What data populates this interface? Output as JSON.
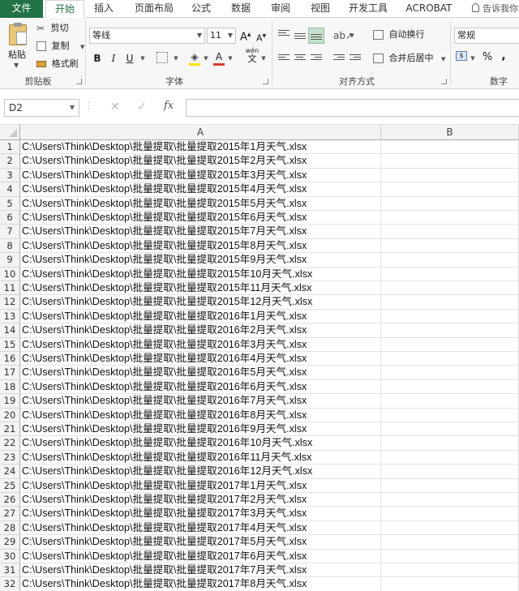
{
  "tabs": {
    "file": "文件",
    "home": "开始",
    "insert": "插入",
    "page_layout": "页面布局",
    "formulas": "公式",
    "data": "数据",
    "review": "审阅",
    "view": "视图",
    "developer": "开发工具",
    "acrobat": "ACROBAT",
    "tell_me": "告诉我你"
  },
  "ribbon": {
    "clipboard": {
      "paste": "粘贴",
      "cut": "剪切",
      "copy": "复制",
      "format_painter": "格式刷",
      "group_label": "剪贴板"
    },
    "font": {
      "font_name": "等线",
      "font_size": "11",
      "bold": "B",
      "italic": "I",
      "underline": "U",
      "phonetic": "wén",
      "phonetic_char": "文",
      "group_label": "字体"
    },
    "alignment": {
      "wrap_text": "自动换行",
      "merge_center": "合并后居中",
      "group_label": "对齐方式"
    },
    "number": {
      "format": "常规",
      "percent": "%",
      "comma": ",",
      "group_label": "数字"
    }
  },
  "formula_bar": {
    "name_box": "D2",
    "fx": "fx",
    "formula": ""
  },
  "columns": [
    "A",
    "B"
  ],
  "rows": [
    {
      "num": "1",
      "a": "C:\\Users\\Think\\Desktop\\批量提取\\批量提取2015年1月天气.xlsx"
    },
    {
      "num": "2",
      "a": "C:\\Users\\Think\\Desktop\\批量提取\\批量提取2015年2月天气.xlsx"
    },
    {
      "num": "3",
      "a": "C:\\Users\\Think\\Desktop\\批量提取\\批量提取2015年3月天气.xlsx"
    },
    {
      "num": "4",
      "a": "C:\\Users\\Think\\Desktop\\批量提取\\批量提取2015年4月天气.xlsx"
    },
    {
      "num": "5",
      "a": "C:\\Users\\Think\\Desktop\\批量提取\\批量提取2015年5月天气.xlsx"
    },
    {
      "num": "6",
      "a": "C:\\Users\\Think\\Desktop\\批量提取\\批量提取2015年6月天气.xlsx"
    },
    {
      "num": "7",
      "a": "C:\\Users\\Think\\Desktop\\批量提取\\批量提取2015年7月天气.xlsx"
    },
    {
      "num": "8",
      "a": "C:\\Users\\Think\\Desktop\\批量提取\\批量提取2015年8月天气.xlsx"
    },
    {
      "num": "9",
      "a": "C:\\Users\\Think\\Desktop\\批量提取\\批量提取2015年9月天气.xlsx"
    },
    {
      "num": "10",
      "a": "C:\\Users\\Think\\Desktop\\批量提取\\批量提取2015年10月天气.xlsx"
    },
    {
      "num": "11",
      "a": "C:\\Users\\Think\\Desktop\\批量提取\\批量提取2015年11月天气.xlsx"
    },
    {
      "num": "12",
      "a": "C:\\Users\\Think\\Desktop\\批量提取\\批量提取2015年12月天气.xlsx"
    },
    {
      "num": "13",
      "a": "C:\\Users\\Think\\Desktop\\批量提取\\批量提取2016年1月天气.xlsx"
    },
    {
      "num": "14",
      "a": "C:\\Users\\Think\\Desktop\\批量提取\\批量提取2016年2月天气.xlsx"
    },
    {
      "num": "15",
      "a": "C:\\Users\\Think\\Desktop\\批量提取\\批量提取2016年3月天气.xlsx"
    },
    {
      "num": "16",
      "a": "C:\\Users\\Think\\Desktop\\批量提取\\批量提取2016年4月天气.xlsx"
    },
    {
      "num": "17",
      "a": "C:\\Users\\Think\\Desktop\\批量提取\\批量提取2016年5月天气.xlsx"
    },
    {
      "num": "18",
      "a": "C:\\Users\\Think\\Desktop\\批量提取\\批量提取2016年6月天气.xlsx"
    },
    {
      "num": "19",
      "a": "C:\\Users\\Think\\Desktop\\批量提取\\批量提取2016年7月天气.xlsx"
    },
    {
      "num": "20",
      "a": "C:\\Users\\Think\\Desktop\\批量提取\\批量提取2016年8月天气.xlsx"
    },
    {
      "num": "21",
      "a": "C:\\Users\\Think\\Desktop\\批量提取\\批量提取2016年9月天气.xlsx"
    },
    {
      "num": "22",
      "a": "C:\\Users\\Think\\Desktop\\批量提取\\批量提取2016年10月天气.xlsx"
    },
    {
      "num": "23",
      "a": "C:\\Users\\Think\\Desktop\\批量提取\\批量提取2016年11月天气.xlsx"
    },
    {
      "num": "24",
      "a": "C:\\Users\\Think\\Desktop\\批量提取\\批量提取2016年12月天气.xlsx"
    },
    {
      "num": "25",
      "a": "C:\\Users\\Think\\Desktop\\批量提取\\批量提取2017年1月天气.xlsx"
    },
    {
      "num": "26",
      "a": "C:\\Users\\Think\\Desktop\\批量提取\\批量提取2017年2月天气.xlsx"
    },
    {
      "num": "27",
      "a": "C:\\Users\\Think\\Desktop\\批量提取\\批量提取2017年3月天气.xlsx"
    },
    {
      "num": "28",
      "a": "C:\\Users\\Think\\Desktop\\批量提取\\批量提取2017年4月天气.xlsx"
    },
    {
      "num": "29",
      "a": "C:\\Users\\Think\\Desktop\\批量提取\\批量提取2017年5月天气.xlsx"
    },
    {
      "num": "30",
      "a": "C:\\Users\\Think\\Desktop\\批量提取\\批量提取2017年6月天气.xlsx"
    },
    {
      "num": "31",
      "a": "C:\\Users\\Think\\Desktop\\批量提取\\批量提取2017年7月天气.xlsx"
    },
    {
      "num": "32",
      "a": "C:\\Users\\Think\\Desktop\\批量提取\\批量提取2017年8月天气.xlsx"
    }
  ],
  "colors": {
    "accent": "#217346",
    "font_color_bar": "#e03c31",
    "fill_color_bar": "#ffe100"
  }
}
